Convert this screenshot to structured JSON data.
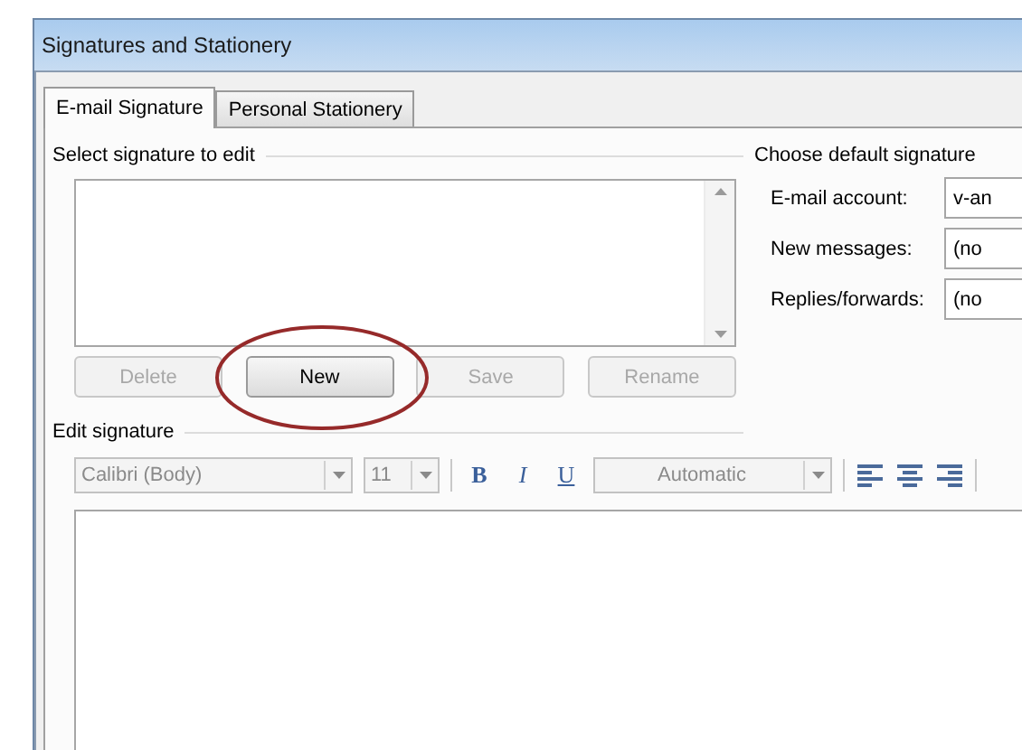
{
  "window": {
    "title": "Signatures and Stationery"
  },
  "tabs": [
    {
      "label": "E-mail Signature",
      "selected": true
    },
    {
      "label": "Personal Stationery",
      "selected": false
    }
  ],
  "select_signature": {
    "heading": "Select signature to edit",
    "buttons": [
      {
        "label": "Delete",
        "disabled": true,
        "highlighted": false
      },
      {
        "label": "New",
        "disabled": false,
        "highlighted": true
      },
      {
        "label": "Save",
        "disabled": true,
        "highlighted": false
      },
      {
        "label": "Rename",
        "disabled": true,
        "highlighted": false
      }
    ]
  },
  "default_signature": {
    "heading": "Choose default signature",
    "fields": [
      {
        "label": "E-mail account:",
        "value": "v-an"
      },
      {
        "label": "New messages:",
        "value": "(no"
      },
      {
        "label": "Replies/forwards:",
        "value": "(no"
      }
    ]
  },
  "edit_signature": {
    "heading": "Edit signature",
    "font": "Calibri (Body)",
    "size": "11",
    "format_buttons": [
      {
        "kind": "bold",
        "label": "B"
      },
      {
        "kind": "italic",
        "label": "I"
      },
      {
        "kind": "underline",
        "label": "U"
      }
    ],
    "font_color_choice": "Automatic",
    "align_buttons": [
      {
        "kind": "left"
      },
      {
        "kind": "center"
      },
      {
        "kind": "right"
      }
    ]
  }
}
